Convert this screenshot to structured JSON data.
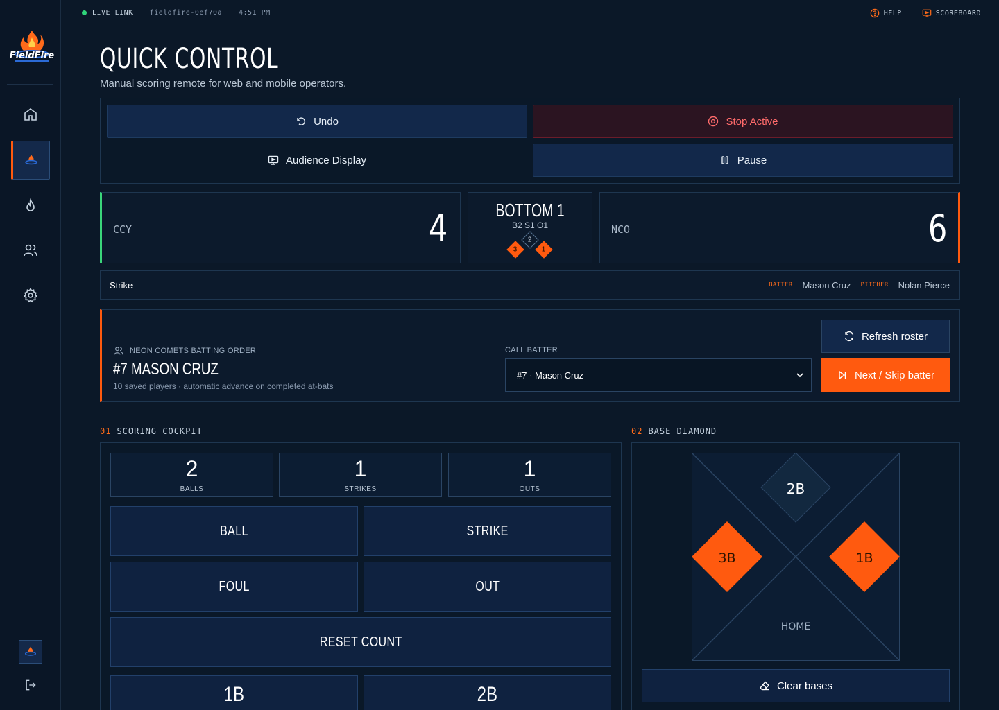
{
  "brand": {
    "name": "FieldFire"
  },
  "topbar": {
    "live_label": "LIVE LINK",
    "session_id": "fieldfire-0ef70a",
    "time": "4:51 PM",
    "help_label": "HELP",
    "scoreboard_label": "SCOREBOARD"
  },
  "page": {
    "title": "QUICK CONTROL",
    "subtitle": "Manual scoring remote for web and mobile operators."
  },
  "controls": {
    "undo": "Undo",
    "stop_active": "Stop Active",
    "audience_display": "Audience Display",
    "pause": "Pause"
  },
  "scoreboard": {
    "away": {
      "code": "CCY",
      "score": "4",
      "color": "#3ad67a"
    },
    "home": {
      "code": "NCO",
      "score": "6",
      "color": "#ff5a0f"
    },
    "inning": "BOTTOM 1",
    "count": "B2 S1 O1",
    "bases": {
      "first": "1",
      "second": "2",
      "third": "3"
    }
  },
  "status": {
    "last_event": "Strike",
    "batter_tag": "BATTER",
    "batter": "Mason Cruz",
    "pitcher_tag": "PITCHER",
    "pitcher": "Nolan Pierce"
  },
  "order": {
    "label": "NEON COMETS BATTING ORDER",
    "current": "#7 MASON CRUZ",
    "note": "10 saved players · automatic advance on completed at-bats",
    "call_label": "CALL BATTER",
    "selected": "#7 · Mason Cruz",
    "refresh": "Refresh roster",
    "next": "Next / Skip batter"
  },
  "sections": {
    "cockpit_num": "01",
    "cockpit": "SCORING COCKPIT",
    "diamond_num": "02",
    "diamond": "BASE DIAMOND"
  },
  "cockpit": {
    "balls": {
      "value": "2",
      "label": "BALLS"
    },
    "strikes": {
      "value": "1",
      "label": "STRIKES"
    },
    "outs": {
      "value": "1",
      "label": "OUTS"
    },
    "ball_btn": "BALL",
    "strike_btn": "STRIKE",
    "foul_btn": "FOUL",
    "out_btn": "OUT",
    "reset_btn": "RESET COUNT",
    "single_btn": "1B",
    "double_btn": "2B"
  },
  "diamond": {
    "second": "2B",
    "third": "3B",
    "first": "1B",
    "home": "HOME",
    "clear": "Clear bases",
    "occupied": {
      "first": true,
      "second": false,
      "third": true
    }
  },
  "colors": {
    "accent": "#ff5a0f",
    "panel": "#0c1a2c",
    "border": "#1e3650",
    "live": "#2fd47a"
  }
}
